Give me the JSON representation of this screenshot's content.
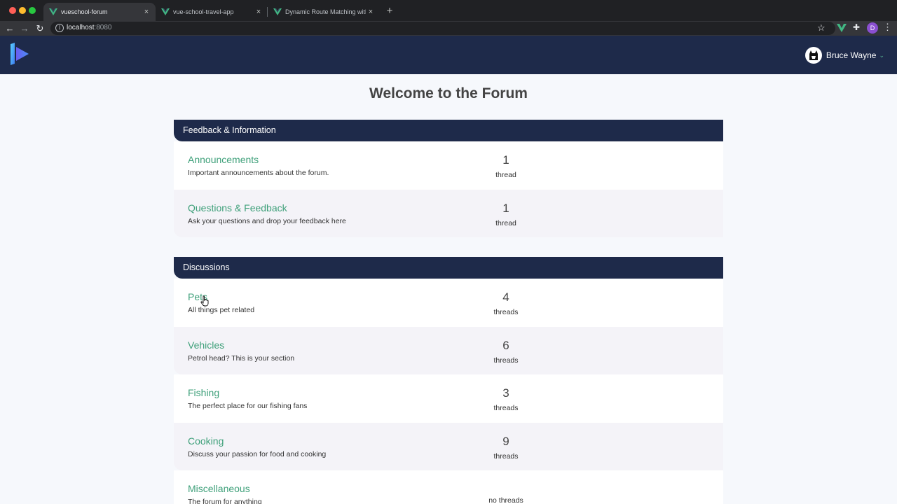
{
  "browser": {
    "tabs": [
      {
        "title": "vueschool-forum",
        "close": "×",
        "active": true
      },
      {
        "title": "vue-school-travel-app",
        "close": "×",
        "active": false
      },
      {
        "title": "Dynamic Route Matching with",
        "close": "×",
        "active": false
      }
    ],
    "new_tab": "+",
    "url_host": "localhost",
    "url_port": ":8080",
    "profile_initial": "D",
    "icons": {
      "back": "←",
      "forward": "→",
      "reload": "↻",
      "info": "i",
      "star": "☆",
      "puzzle": "✚",
      "menu": "⋮"
    }
  },
  "header": {
    "user_name": "Bruce Wayne",
    "caret": "⌄"
  },
  "page": {
    "title": "Welcome to the Forum"
  },
  "categories": [
    {
      "name": "Feedback & Information",
      "forums": [
        {
          "name": "Announcements",
          "description": "Important announcements about the forum.",
          "count": "1",
          "threads_label": "thread"
        },
        {
          "name": "Questions & Feedback",
          "description": "Ask your questions and drop your feedback here",
          "count": "1",
          "threads_label": "thread"
        }
      ]
    },
    {
      "name": "Discussions",
      "forums": [
        {
          "name": "Pets",
          "description": "All things pet related",
          "count": "4",
          "threads_label": "threads"
        },
        {
          "name": "Vehicles",
          "description": "Petrol head? This is your section",
          "count": "6",
          "threads_label": "threads"
        },
        {
          "name": "Fishing",
          "description": "The perfect place for our fishing fans",
          "count": "3",
          "threads_label": "threads"
        },
        {
          "name": "Cooking",
          "description": "Discuss your passion for food and cooking",
          "count": "9",
          "threads_label": "threads"
        },
        {
          "name": "Miscellaneous",
          "description": "The forum for anything",
          "count": "",
          "threads_label": "no threads"
        }
      ]
    }
  ],
  "colors": {
    "header_bg": "#1e2a4a",
    "link_green": "#3fa07a",
    "page_bg": "#f6f8fc"
  }
}
